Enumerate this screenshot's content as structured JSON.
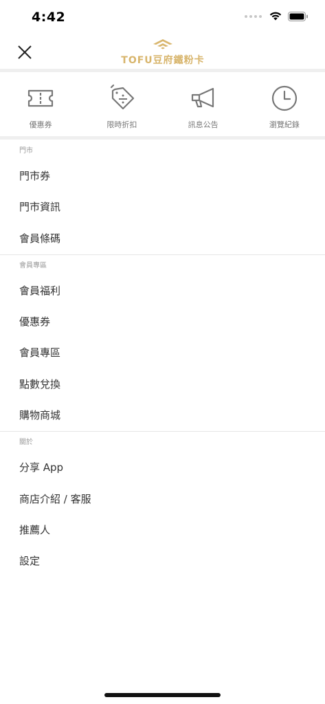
{
  "status_bar": {
    "time": "4:42"
  },
  "header": {
    "brand": "TOFU豆府鐵粉卡",
    "brand_color": "#d8b56c",
    "close_icon": "close-icon"
  },
  "quick_actions": [
    {
      "label": "優惠券",
      "icon": "ticket-icon"
    },
    {
      "label": "限時折扣",
      "icon": "discount-tag-icon"
    },
    {
      "label": "訊息公告",
      "icon": "megaphone-icon"
    },
    {
      "label": "瀏覽紀錄",
      "icon": "clock-icon"
    }
  ],
  "sections": [
    {
      "title": "門市",
      "items": [
        "門市券",
        "門市資訊",
        "會員條碼"
      ]
    },
    {
      "title": "會員專區",
      "items": [
        "會員福利",
        "優惠券",
        "會員專區",
        "點數兌換",
        "購物商城"
      ]
    },
    {
      "title": "關於",
      "items": [
        "分享 App",
        "商店介紹 / 客服",
        "推薦人",
        "設定"
      ]
    }
  ]
}
